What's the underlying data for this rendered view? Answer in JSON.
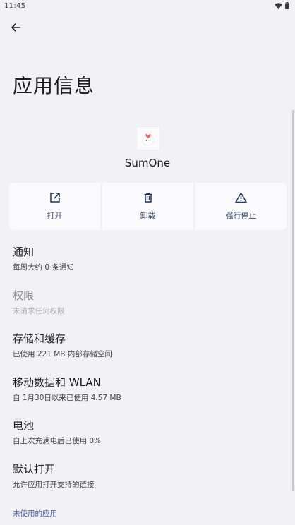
{
  "status_bar": {
    "time": "11:45",
    "icons": [
      "wifi-icon",
      "battery-icon"
    ]
  },
  "header": {
    "back_icon": "arrow-left-icon",
    "title": "应用信息"
  },
  "app": {
    "name": "SumOne",
    "icon": "sumone-app-icon"
  },
  "actions": [
    {
      "label": "打开",
      "icon": "open-external-icon"
    },
    {
      "label": "卸载",
      "icon": "trash-icon"
    },
    {
      "label": "强行停止",
      "icon": "warning-triangle-icon"
    }
  ],
  "settings": [
    {
      "title": "通知",
      "subtitle": "每周大约 0 条通知",
      "enabled": true
    },
    {
      "title": "权限",
      "subtitle": "未请求任何权限",
      "enabled": false
    },
    {
      "title": "存储和缓存",
      "subtitle": "已使用 221 MB 内部存储空间",
      "enabled": true
    },
    {
      "title": "移动数据和 WLAN",
      "subtitle": "自 1月30日以来已使用 4.57 MB",
      "enabled": true
    },
    {
      "title": "电池",
      "subtitle": "自上次充满电后已使用 0%",
      "enabled": true
    },
    {
      "title": "默认打开",
      "subtitle": "允许应用打开支持的链接",
      "enabled": true
    }
  ],
  "footer": {
    "label": "未使用的应用"
  },
  "colors": {
    "background": "#f2f1f6",
    "accent": "#3f5a9a",
    "card": "#fbfbfe"
  }
}
